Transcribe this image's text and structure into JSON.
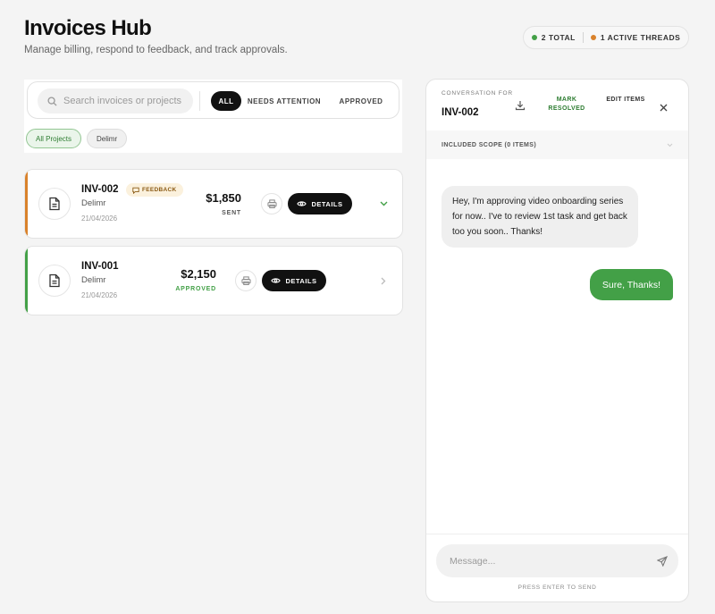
{
  "header": {
    "title": "Invoices Hub",
    "subtitle": "Manage billing, respond to feedback, and track approvals."
  },
  "stats": {
    "total_label": "2 TOTAL",
    "threads_label": "1 ACTIVE THREADS",
    "total_color": "#43a047",
    "threads_color": "#d9822b"
  },
  "search": {
    "placeholder": "Search invoices or projects..."
  },
  "filters": {
    "tabs": [
      "ALL",
      "NEEDS ATTENTION",
      "APPROVED"
    ],
    "active_tab": "ALL"
  },
  "project_chips": [
    "All Projects",
    "Delimr"
  ],
  "invoices": [
    {
      "id": "INV-002",
      "client": "Delimr",
      "date": "21/04/2026",
      "badge": "FEEDBACK",
      "amount": "$1,850",
      "status": "SENT",
      "accent": "#d9822b",
      "status_color": "#555555",
      "details_label": "DETAILS",
      "expanded": true
    },
    {
      "id": "INV-001",
      "client": "Delimr",
      "date": "21/04/2026",
      "amount": "$2,150",
      "status": "APPROVED",
      "accent": "#43a047",
      "status_color": "#43a047",
      "details_label": "DETAILS",
      "expanded": false
    }
  ],
  "conversation": {
    "label": "CONVERSATION FOR",
    "invoice_id": "INV-002",
    "mark_resolved_label": "MARK RESOLVED",
    "edit_items_label": "EDIT ITEMS",
    "scope_label": "INCLUDED SCOPE (0 ITEMS)",
    "messages": [
      {
        "direction": "incoming",
        "text": "Hey, I'm approving video onboarding series for now.. I've to review 1st task and get back too you soon.. Thanks!"
      },
      {
        "direction": "outgoing",
        "text": "Sure, Thanks!"
      }
    ],
    "composer_placeholder": "Message...",
    "hint": "PRESS ENTER TO SEND"
  }
}
